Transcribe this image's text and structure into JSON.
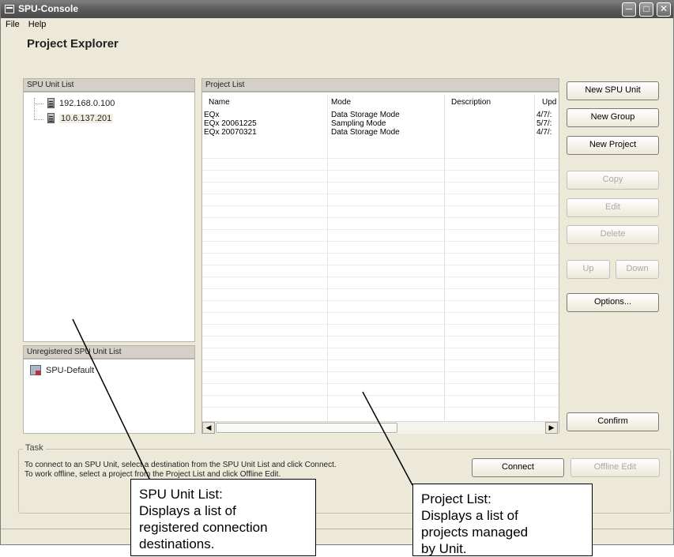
{
  "window": {
    "title": "SPU-Console"
  },
  "menu": {
    "file": "File",
    "help": "Help"
  },
  "explorer": {
    "title": "Project Explorer"
  },
  "unit_list": {
    "header": "SPU Unit List",
    "items": [
      "192.168.0.100",
      "10.6.137.201"
    ]
  },
  "unregistered": {
    "header": "Unregistered SPU Unit List",
    "items": [
      "SPU-Default"
    ]
  },
  "project_list": {
    "header": "Project List",
    "columns": [
      "Name",
      "Mode",
      "Description",
      "Upd"
    ],
    "rows": [
      [
        "EQx",
        "Data Storage Mode",
        "",
        "4/7/:"
      ],
      [
        "EQx 20061225",
        "Sampling Mode",
        "",
        "5/7/:"
      ],
      [
        "EQx 20070321",
        "Data Storage Mode",
        "",
        "4/7/:"
      ]
    ]
  },
  "buttons": {
    "new_spu_unit": "New SPU Unit",
    "new_group": "New Group",
    "new_project": "New Project",
    "copy": "Copy",
    "edit": "Edit",
    "delete": "Delete",
    "up": "Up",
    "down": "Down",
    "options": "Options...",
    "confirm": "Confirm",
    "connect": "Connect",
    "offline_edit": "Offline Edit"
  },
  "task": {
    "title": "Task",
    "line1": "To connect to an SPU Unit, select a destination from the SPU Unit List and click Connect.",
    "line2": "To work offline, select a project from the Project List and click Offline Edit."
  },
  "callouts": {
    "unit_list": [
      "SPU Unit List:",
      "Displays a list of",
      "registered connection",
      "destinations."
    ],
    "project_list": [
      "Project List:",
      "Displays a list of",
      "projects managed",
      "by Unit."
    ]
  }
}
